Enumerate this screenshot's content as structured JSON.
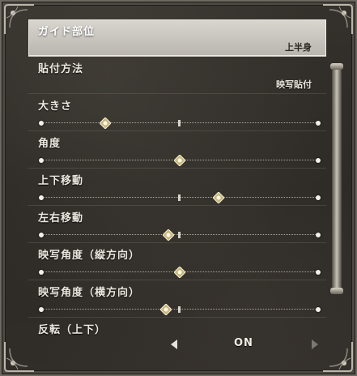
{
  "settings": [
    {
      "label": "ガイド部位",
      "type": "select",
      "value": "上半身",
      "selected": true
    },
    {
      "label": "貼付方法",
      "type": "select",
      "value": "映写貼付"
    },
    {
      "label": "大きさ",
      "type": "slider",
      "level": 0.23
    },
    {
      "label": "角度",
      "type": "slider",
      "level": 0.5
    },
    {
      "label": "上下移動",
      "type": "slider",
      "level": 0.64
    },
    {
      "label": "左右移動",
      "type": "slider",
      "level": 0.46
    },
    {
      "label": "映写角度（縦方向）",
      "type": "slider",
      "level": 0.5
    },
    {
      "label": "映写角度（横方向）",
      "type": "slider",
      "level": 0.45
    },
    {
      "label": "反転（上下）",
      "type": "toggle",
      "value": "ON"
    }
  ],
  "scroll": {
    "position": 0.0
  },
  "colors": {
    "panel": "#2b2824",
    "selected_row": "#c9c6c0",
    "text": "#ece8e0",
    "thumb_gold": "#c9b680"
  }
}
